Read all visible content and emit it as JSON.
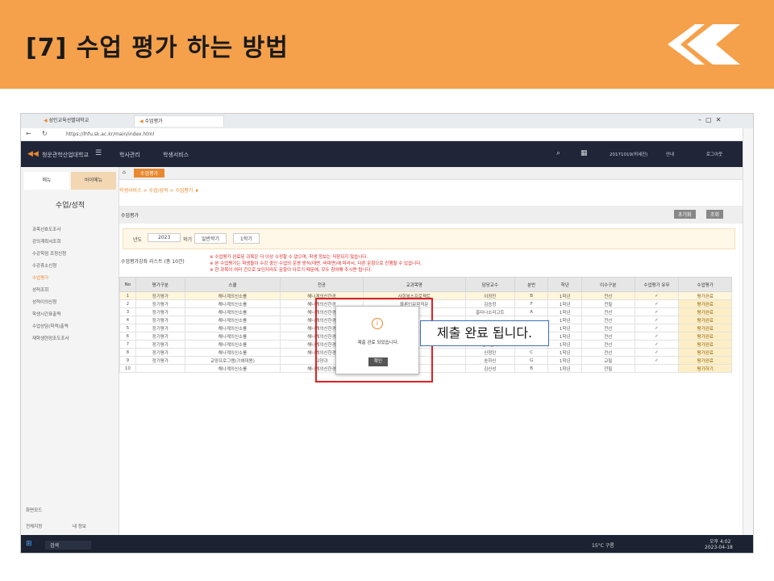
{
  "banner": {
    "title": "[7] 수업 평가 하는 방법"
  },
  "browser": {
    "tab1": "성인교육선별대학교",
    "tab2": "수업평가",
    "url": "https://lhfu.sk.ac.kr/main/index.html"
  },
  "app": {
    "school": "청운관학산업대학교",
    "nav1": "학사관리",
    "nav2": "학생서비스",
    "user": "20171019(허세진)",
    "link1": "안내",
    "logout": "로그아웃"
  },
  "sidebar": {
    "tab_menu": "메뉴",
    "tab_bookmark": "바이메뉴",
    "title": "수업/성적",
    "items": [
      "과목선호도조사",
      "강의계획서조회",
      "수강학점 조정신청",
      "수강휴소신청",
      "수업평가",
      "성적조회",
      "성적이의신청",
      "학생시간표출력",
      "수업상담(학적)출력",
      "재학생현장조도조사"
    ],
    "bottom": "화면모드",
    "bottom2": "전체지정",
    "bottom3": "내 정보"
  },
  "main": {
    "page_tab": "수업평가",
    "breadcrumb": "학생서비스 > 수업/성적 > 수업평가 ★",
    "section": "수업평가",
    "btn_reset": "초기화",
    "btn_search": "조회",
    "year_label": "년도",
    "year": "2023",
    "term_label": "학기",
    "term": "일반학기",
    "term2": "1학기",
    "list_label": "수업평가강좌 리스트 (총 10건)",
    "note1": "※ 수업평가 완료된 과목은 더 이상 수정할 수 없으며, 학생 정보는 저장되지 않습니다.",
    "note2": "※ 본 수업평가는 학생들이 수강 중인 수업의 운영 방식(대면, 비대면)에 따라서, 다른 문항으로 진행될 수 있습니다.",
    "note3": "※ 한 과목이 여러 건으로 보인지라도 문항이 다르기 때문에, 모두 참여해 주시면 됩니다."
  },
  "table": {
    "headers": [
      "No",
      "평가구분",
      "스쿨",
      "전공",
      "교과목명",
      "담당교수",
      "분반",
      "학년",
      "이수구분",
      "수업평가 유무",
      "수업평가"
    ],
    "rows": [
      [
        "1",
        "정기평가",
        "해나계의신소를",
        "해나계의신한경",
        "사회복스프로젝트",
        "이정진",
        "B",
        "1학년",
        "전선",
        "✓",
        "평가완료"
      ],
      [
        "2",
        "정기평가",
        "해나계의신소를",
        "해나계의신한경",
        "물론인문학적문",
        "김승정",
        "F",
        "1학년",
        "전필",
        "✓",
        "평가완료"
      ],
      [
        "3",
        "정기평가",
        "해나계의신소를",
        "해나계의신한경",
        "",
        "흥타나소리고트",
        "A",
        "1학년",
        "전선",
        "✓",
        "평가완료"
      ],
      [
        "4",
        "정기평가",
        "해나계의신소를",
        "해나계의신한경",
        "",
        "",
        "",
        "1학년",
        "전선",
        "✓",
        "평가완료"
      ],
      [
        "5",
        "정기평가",
        "해나계의신소를",
        "해나계의신한경",
        "",
        "",
        "",
        "1학년",
        "전선",
        "✓",
        "평가완료"
      ],
      [
        "6",
        "정기평가",
        "해나계의신소를",
        "해나계의신한경",
        "",
        "",
        "",
        "1학년",
        "전선",
        "✓",
        "평가완료"
      ],
      [
        "7",
        "정기평가",
        "해나계의신소를",
        "해나계의신한경",
        "",
        "혈어른피",
        "A",
        "1학년",
        "전선",
        "✓",
        "평가완료"
      ],
      [
        "8",
        "정기평가",
        "해나계의신소를",
        "해나계의신한경",
        "",
        "신청인",
        "C",
        "1학년",
        "전선",
        "✓",
        "평가완료"
      ],
      [
        "9",
        "정기평가",
        "교양프로그램(기예대용)",
        "교양과",
        "",
        "송하신",
        "G",
        "1학년",
        "교필",
        "✓",
        "평가완료"
      ],
      [
        "10",
        "",
        "해나계의신소를",
        "해나계의신한경",
        "",
        "김신성",
        "B",
        "1학년",
        "전필",
        "",
        "평가하기"
      ]
    ]
  },
  "dialog": {
    "message": "제출 완료 되었습니다.",
    "button": "확인"
  },
  "callout": {
    "text": "제출 완료 됩니다."
  },
  "taskbar": {
    "search": "검색",
    "weather": "15°C 구름",
    "time": "오후 4:02",
    "date": "2023-04-18"
  },
  "colors": {
    "banner": "#f5a04a",
    "highlight": "#e02020",
    "header": "#202538"
  }
}
